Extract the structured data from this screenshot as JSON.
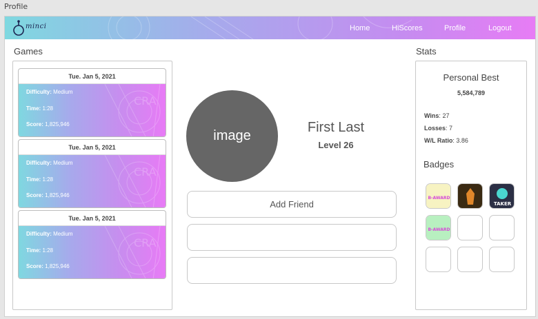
{
  "window": {
    "title": "Profile"
  },
  "brand": {
    "logo_text": "minci"
  },
  "nav": {
    "items": [
      {
        "label": "Home"
      },
      {
        "label": "HiScores"
      },
      {
        "label": "Profile"
      },
      {
        "label": "Logout"
      }
    ]
  },
  "games": {
    "title": "Games",
    "cards": [
      {
        "date": "Tue. Jan 5, 2021",
        "difficulty_label": "Difficulty:",
        "difficulty": "Medium",
        "time_label": "Time:",
        "time": "1:28",
        "score_label": "Score:",
        "score": "1,825,946"
      },
      {
        "date": "Tue. Jan 5, 2021",
        "difficulty_label": "Difficulty:",
        "difficulty": "Medium",
        "time_label": "Time:",
        "time": "1:28",
        "score_label": "Score:",
        "score": "1,825,946"
      },
      {
        "date": "Tue. Jan 5, 2021",
        "difficulty_label": "Difficulty:",
        "difficulty": "Medium",
        "time_label": "Time:",
        "time": "1:28",
        "score_label": "Score:",
        "score": "1,825,946"
      }
    ]
  },
  "profile": {
    "avatar_text": "image",
    "name": "First Last",
    "level": "Level 26",
    "buttons": [
      {
        "label": "Add Friend"
      },
      {
        "label": ""
      },
      {
        "label": ""
      }
    ]
  },
  "stats": {
    "title": "Stats",
    "personal_best_title": "Personal Best",
    "personal_best": "5,584,789",
    "wins_label": "Wins",
    "wins": "27",
    "losses_label": "Losses",
    "losses": "7",
    "ratio_label": "W/L Ratio",
    "ratio": "3.86",
    "badges_title": "Badges",
    "badges": [
      {
        "icon": "yellow-pink-text-badge-icon",
        "text": "B-AWARD",
        "bg": "#f7f3c2",
        "fg": "#d64bd8"
      },
      {
        "icon": "red-figure-badge-icon",
        "text": "",
        "bg": "#3a2a12",
        "fg": "#e0872a"
      },
      {
        "icon": "taker-badge-icon",
        "text": "TAKER",
        "bg": "#2b2f45",
        "fg": "#ffffff"
      },
      {
        "icon": "green-pink-text-badge-icon",
        "text": "B-AWARD",
        "bg": "#b8f0c0",
        "fg": "#d64bd8"
      },
      {
        "icon": "empty-badge-slot",
        "text": "",
        "bg": "#ffffff",
        "fg": "#ffffff"
      },
      {
        "icon": "empty-badge-slot",
        "text": "",
        "bg": "#ffffff",
        "fg": "#ffffff"
      },
      {
        "icon": "empty-badge-slot",
        "text": "",
        "bg": "#ffffff",
        "fg": "#ffffff"
      },
      {
        "icon": "empty-badge-slot",
        "text": "",
        "bg": "#ffffff",
        "fg": "#ffffff"
      },
      {
        "icon": "empty-badge-slot",
        "text": "",
        "bg": "#ffffff",
        "fg": "#ffffff"
      }
    ]
  },
  "colors": {
    "gradient_start": "#7fd8e0",
    "gradient_mid": "#c58cf0",
    "gradient_end": "#e77cf5",
    "avatar": "#666666"
  }
}
